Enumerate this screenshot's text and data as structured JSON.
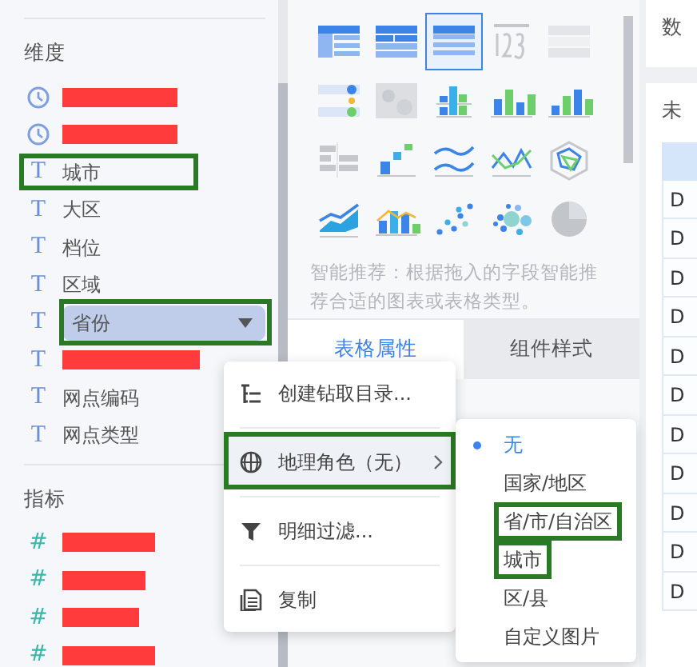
{
  "dimensions": {
    "title": "维度",
    "items": [
      {
        "kind": "date",
        "redacted": true,
        "selected": false
      },
      {
        "kind": "date",
        "redacted": true,
        "selected": false
      },
      {
        "kind": "text",
        "icon": "T",
        "label": "城市",
        "selected": false,
        "highlighted": true
      },
      {
        "kind": "text",
        "icon": "T",
        "label": "大区",
        "selected": false
      },
      {
        "kind": "text",
        "icon": "T",
        "label": "档位",
        "selected": false
      },
      {
        "kind": "text",
        "icon": "T",
        "label": "区域",
        "selected": false
      },
      {
        "kind": "text",
        "icon": "T",
        "label": "省份",
        "selected": true,
        "highlighted": true
      },
      {
        "kind": "text",
        "icon": "T",
        "redacted": true,
        "selected": false
      },
      {
        "kind": "text",
        "icon": "T",
        "label": "网点编码",
        "selected": false
      },
      {
        "kind": "text",
        "icon": "T",
        "label": "网点类型",
        "selected": false
      }
    ]
  },
  "measures": {
    "title": "指标",
    "items": [
      {
        "kind": "measure",
        "icon": "#",
        "redacted": true
      },
      {
        "kind": "measure",
        "icon": "#",
        "redacted": true
      },
      {
        "kind": "measure",
        "icon": "#",
        "redacted": true
      },
      {
        "kind": "measure",
        "icon": "#",
        "redacted": true
      }
    ]
  },
  "chart_types": [
    {
      "kind": "cross-table",
      "selected": false
    },
    {
      "kind": "group-table",
      "selected": false
    },
    {
      "kind": "detail-table",
      "selected": true
    },
    {
      "kind": "number",
      "selected": false
    },
    {
      "kind": "kpi-list",
      "selected": false
    },
    {
      "kind": "indicator-list",
      "selected": false
    },
    {
      "kind": "heatmap",
      "selected": false
    },
    {
      "kind": "stacked-bar",
      "selected": false
    },
    {
      "kind": "grouped-bar",
      "selected": false
    },
    {
      "kind": "bar",
      "selected": false
    },
    {
      "kind": "ranked-bar",
      "selected": false
    },
    {
      "kind": "step",
      "selected": false
    },
    {
      "kind": "multi-line",
      "selected": false
    },
    {
      "kind": "line",
      "selected": false
    },
    {
      "kind": "radar",
      "selected": false
    },
    {
      "kind": "area",
      "selected": false
    },
    {
      "kind": "combo",
      "selected": false
    },
    {
      "kind": "scatter",
      "selected": false
    },
    {
      "kind": "bubble",
      "selected": false
    },
    {
      "kind": "pie",
      "selected": false
    }
  ],
  "recommend_note": "智能推荐：根据拖入的字段智能推荐合适的图表或表格类型。",
  "tabs": [
    {
      "label": "表格属性",
      "selected": true
    },
    {
      "label": "组件样式",
      "selected": false
    }
  ],
  "context_menu": [
    {
      "kind": "drill",
      "label": "创建钻取目录...",
      "submenu": false,
      "hovered": false
    },
    {
      "kind": "geo",
      "label": "地理角色（无）",
      "submenu": true,
      "hovered": true,
      "highlighted": true
    },
    {
      "kind": "filter",
      "label": "明细过滤...",
      "submenu": false,
      "hovered": false
    },
    {
      "kind": "copy",
      "label": "复制",
      "submenu": false,
      "hovered": false
    }
  ],
  "geo_submenu": [
    {
      "label": "无",
      "selected": true
    },
    {
      "label": "国家/地区",
      "selected": false
    },
    {
      "label": "省/市/自治区",
      "selected": false,
      "highlighted": true
    },
    {
      "label": "城市",
      "selected": false,
      "highlighted": true
    },
    {
      "label": "区/县",
      "selected": false
    },
    {
      "label": "自定义图片",
      "selected": false
    }
  ],
  "right_panel": {
    "top_title": "数",
    "table_title": "未",
    "cells": [
      "D",
      "D",
      "D",
      "D",
      "D",
      "D",
      "D",
      "D",
      "D",
      "D",
      "D"
    ]
  }
}
